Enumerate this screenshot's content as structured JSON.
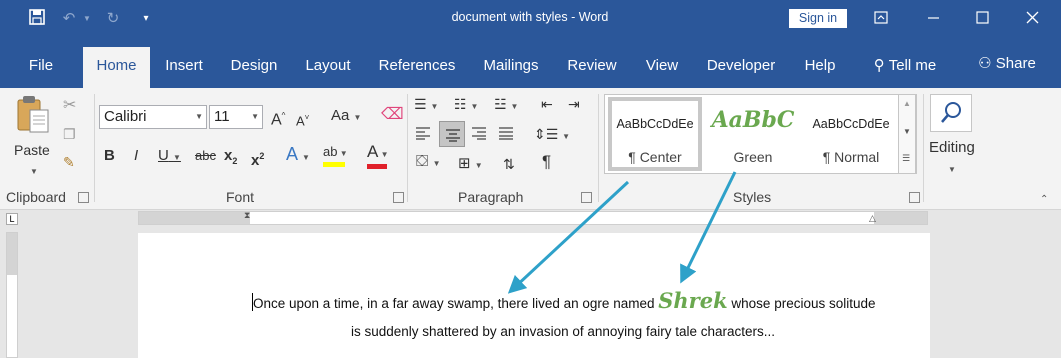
{
  "titlebar": {
    "document_title": "document with styles  -  Word",
    "sign_in": "Sign in"
  },
  "tabs": [
    "File",
    "Home",
    "Insert",
    "Design",
    "Layout",
    "References",
    "Mailings",
    "Review",
    "View",
    "Developer",
    "Help"
  ],
  "tell_me": "Tell me",
  "share": "Share",
  "clipboard": {
    "paste": "Paste",
    "label": "Clipboard"
  },
  "font": {
    "name": "Calibri",
    "size": "11",
    "label": "Font",
    "bold": "B",
    "italic": "I",
    "underline": "U",
    "strike": "abc",
    "case": "Aa",
    "subscript": "x",
    "sub_mark": "2",
    "superscript": "x",
    "sup_mark": "2",
    "grow": "A",
    "shrink": "A",
    "text_effects": "A",
    "highlight_glyph": "ab",
    "font_color_glyph": "A"
  },
  "paragraph": {
    "label": "Paragraph",
    "pilcrow": "¶"
  },
  "styles": {
    "label": "Styles",
    "items": [
      {
        "sample": "AaBbCcDdEe",
        "name": "¶ Center"
      },
      {
        "sample": "AaBbC",
        "name": "Green"
      },
      {
        "sample": "AaBbCcDdEe",
        "name": "¶ Normal"
      }
    ]
  },
  "editing": {
    "label": "Editing"
  },
  "document": {
    "line1_before": "Once upon a time, in a far away swamp, there lived an ogre named",
    "highlight_word": "Shrek",
    "line1_after": "whose precious solitude",
    "line2": "is suddenly shattered by an invasion of annoying fairy tale characters..."
  },
  "colors": {
    "title_bar": "#2b579a",
    "ribbon": "#f3f3f3",
    "green_style": "#6aa84f",
    "annotation_arrow": "#2ea1c9",
    "highlight_yellow": "#ffff00",
    "font_red": "#e0202a"
  }
}
